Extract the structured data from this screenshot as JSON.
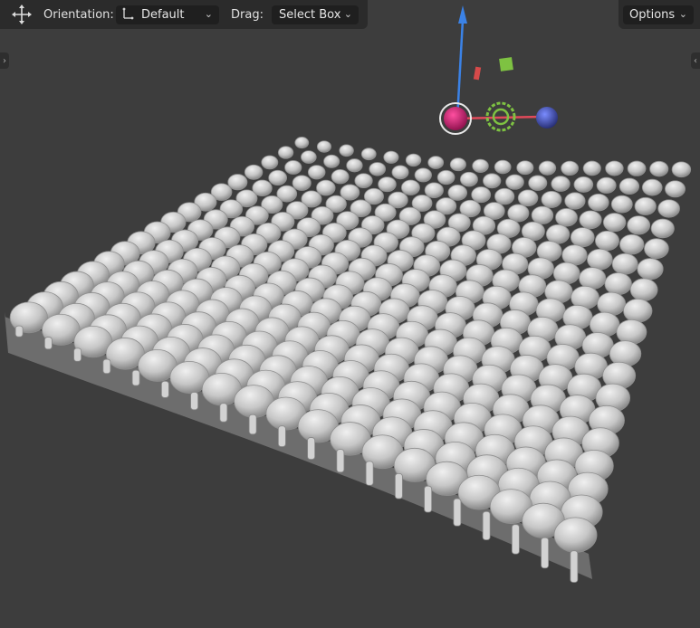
{
  "header": {
    "transform_icon": "move-arrows-icon",
    "orientation_label": "Orientation:",
    "orientation_icon": "orientation-axes-icon",
    "orientation_value": "Default",
    "drag_label": "Drag:",
    "drag_value": "Select Box",
    "options_label": "Options"
  },
  "colors": {
    "viewport_bg": "#3d3d3d",
    "header_bg": "#2b2b2b",
    "mesh": "#c8c8c8",
    "gizmo_z": "#3b82e6",
    "gizmo_x": "#e04a5a",
    "gizmo_y": "#7ec242"
  }
}
